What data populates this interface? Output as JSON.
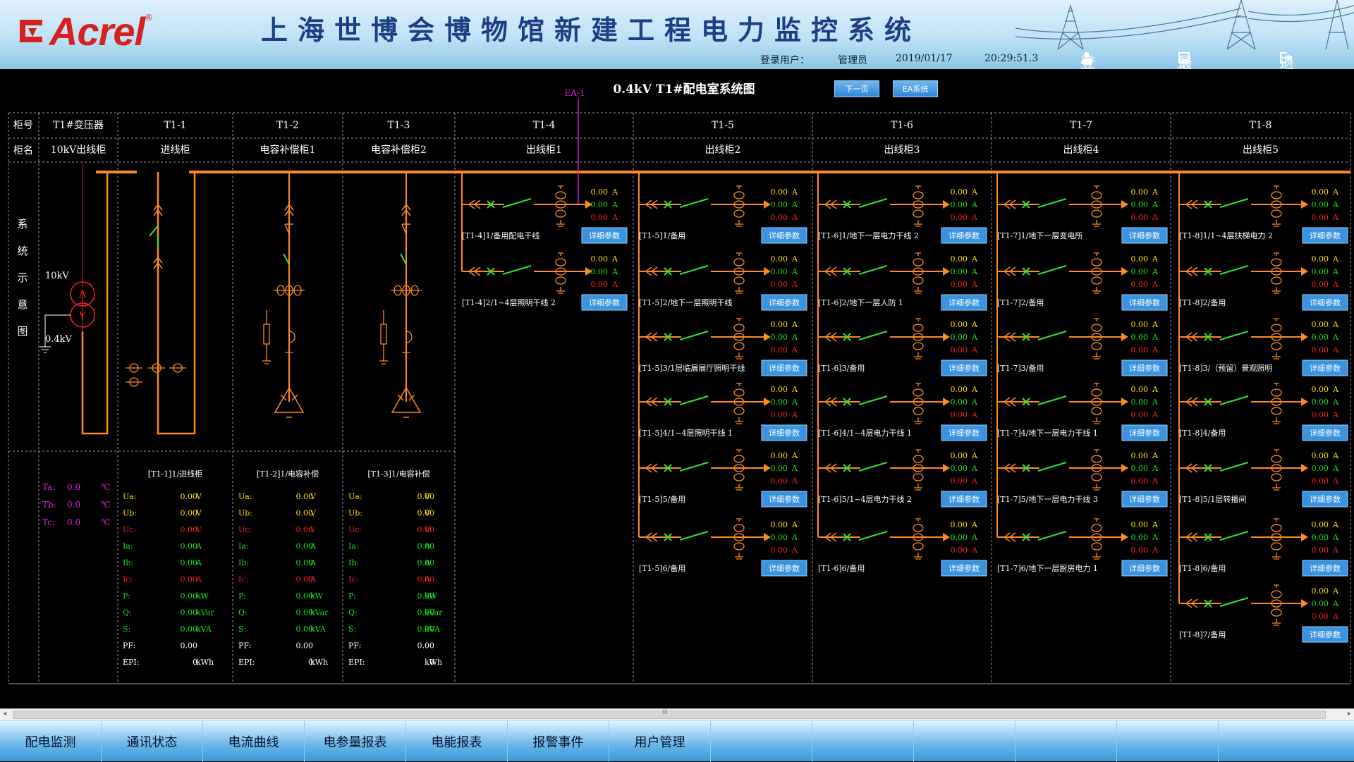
{
  "header": {
    "brand": "Acrel",
    "reg": "®",
    "title": "上海世博会博物馆新建工程电力监控系统",
    "user_label": "登录用户：",
    "user": "管理员",
    "date": "2019/01/17",
    "time": "20:29:51.3",
    "login": "登录",
    "minimize": "最小化",
    "exit": "退出"
  },
  "toolbar": {
    "diagram_title": "0.4kV T1#配电室系统图",
    "next_page": "下一页",
    "ea_system": "EA系统",
    "ea_marker": "EA-1"
  },
  "table": {
    "row_label_no": "柜号",
    "row_label_name": "柜名",
    "side_label": [
      "系",
      "统",
      "示",
      "意",
      "图"
    ],
    "columns": [
      {
        "no": "T1#变压器",
        "name": "10kV出线柜"
      },
      {
        "no": "T1-1",
        "name": "进线柜"
      },
      {
        "no": "T1-2",
        "name": "电容补偿柜1"
      },
      {
        "no": "T1-3",
        "name": "电容补偿柜2"
      },
      {
        "no": "T1-4",
        "name": "出线柜1"
      },
      {
        "no": "T1-5",
        "name": "出线柜2"
      },
      {
        "no": "T1-6",
        "name": "出线柜3"
      },
      {
        "no": "T1-7",
        "name": "出线柜4"
      },
      {
        "no": "T1-8",
        "name": "出线柜5"
      }
    ]
  },
  "transformer": {
    "hv": "10kV",
    "lv": "0.4kV",
    "temps": [
      {
        "label": "Ta:",
        "value": "0.0",
        "unit": "℃"
      },
      {
        "label": "Tb:",
        "value": "0.0",
        "unit": "℃"
      },
      {
        "label": "Tc:",
        "value": "0.0",
        "unit": "℃"
      }
    ]
  },
  "meters": [
    {
      "title": "[T1-1]1/进线柜",
      "rows": [
        {
          "l": "Ua:",
          "v": "0.00",
          "u": "V"
        },
        {
          "l": "Ub:",
          "v": "0.00",
          "u": "V"
        },
        {
          "l": "Uc:",
          "v": "0.00",
          "u": "V"
        },
        {
          "l": "Ia:",
          "v": "0.00",
          "u": "A"
        },
        {
          "l": "Ib:",
          "v": "0.00",
          "u": "A"
        },
        {
          "l": "Ic:",
          "v": "0.00",
          "u": "A"
        },
        {
          "l": "P:",
          "v": "0.00",
          "u": "kW"
        },
        {
          "l": "Q:",
          "v": "0.00",
          "u": "kVar"
        },
        {
          "l": "S:",
          "v": "0.00",
          "u": "kVA"
        },
        {
          "l": "PF:",
          "v": "0.00",
          "u": ""
        },
        {
          "l": "EPI:",
          "v": "0",
          "u": "kWh"
        }
      ]
    },
    {
      "title": "[T1-2]1/电容补偿",
      "rows": [
        {
          "l": "Ua:",
          "v": "0.00",
          "u": "V"
        },
        {
          "l": "Ub:",
          "v": "0.00",
          "u": "V"
        },
        {
          "l": "Uc:",
          "v": "0.00",
          "u": "V"
        },
        {
          "l": "Ia:",
          "v": "0.00",
          "u": "A"
        },
        {
          "l": "Ib:",
          "v": "0.00",
          "u": "A"
        },
        {
          "l": "Ic:",
          "v": "0.00",
          "u": "A"
        },
        {
          "l": "P:",
          "v": "0.00",
          "u": "kW"
        },
        {
          "l": "Q:",
          "v": "0.00",
          "u": "kVar"
        },
        {
          "l": "S:",
          "v": "0.00",
          "u": "kVA"
        },
        {
          "l": "PF:",
          "v": "0.00",
          "u": ""
        },
        {
          "l": "EPI:",
          "v": "0",
          "u": "kWh"
        }
      ]
    },
    {
      "title": "[T1-3]1/电容补偿",
      "rows": [
        {
          "l": "Ua:",
          "v": "0.00",
          "u": "V"
        },
        {
          "l": "Ub:",
          "v": "0.00",
          "u": "V"
        },
        {
          "l": "Uc:",
          "v": "0.00",
          "u": "V"
        },
        {
          "l": "Ia:",
          "v": "0.00",
          "u": "A"
        },
        {
          "l": "Ib:",
          "v": "0.00",
          "u": "A"
        },
        {
          "l": "Ic:",
          "v": "0.00",
          "u": "A"
        },
        {
          "l": "P:",
          "v": "0.00",
          "u": "kW"
        },
        {
          "l": "Q:",
          "v": "0.00",
          "u": "kVar"
        },
        {
          "l": "S:",
          "v": "0.00",
          "u": "kVA"
        },
        {
          "l": "PF:",
          "v": "0.00",
          "u": ""
        },
        {
          "l": "EPI:",
          "v": "0",
          "u": "kWh"
        }
      ]
    }
  ],
  "feeder_values": {
    "a": "0.00",
    "b": "0.00",
    "c": "0.00",
    "unit": "A"
  },
  "detail_label": "详细参数",
  "feeders": [
    [
      "[T1-4]1/备用配电干线",
      "[T1-4]2/1~4层照明干线 2"
    ],
    [
      "[T1-5]1/备用",
      "[T1-5]2/地下一层照明干线",
      "[T1-5]3/1层临展展厅照明干线",
      "[T1-5]4/1~4层照明干线 1",
      "[T1-5]5/备用",
      "[T1-5]6/备用"
    ],
    [
      "[T1-6]1/地下一层电力干线 2",
      "[T1-6]2/地下一层人防 1",
      "[T1-6]3/备用",
      "[T1-6]4/1~4层电力干线 1",
      "[T1-6]5/1~4层电力干线 2",
      "[T1-6]6/备用"
    ],
    [
      "[T1-7]1/地下一层变电所",
      "[T1-7]2/备用",
      "[T1-7]3/备用",
      "[T1-7]4/地下一层电力干线 1",
      "[T1-7]5/地下一层电力干线 3",
      "[T1-7]6/地下一层厨房电力 1"
    ],
    [
      "[T1-8]1/1~4层扶梯电力 2",
      "[T1-8]2/备用",
      "[T1-8]3/（预留）景观照明",
      "[T1-8]4/备用",
      "[T1-8]5/1层转播间",
      "[T1-8]6/备用",
      "[T1-8]7/备用"
    ]
  ],
  "scroll_grip": "III",
  "nav": [
    "配电监测",
    "通讯状态",
    "电流曲线",
    "电参量报表",
    "电能报表",
    "报警事件",
    "用户管理"
  ],
  "colors": {
    "bus": "#ff8a1e",
    "closed": "#2ee82e",
    "phase_a": "#ffe000",
    "phase_b": "#18e818",
    "phase_c": "#ff2020",
    "grid": "#7a7a7a",
    "ea": "#cc22cc",
    "temp": "#e020e0"
  }
}
